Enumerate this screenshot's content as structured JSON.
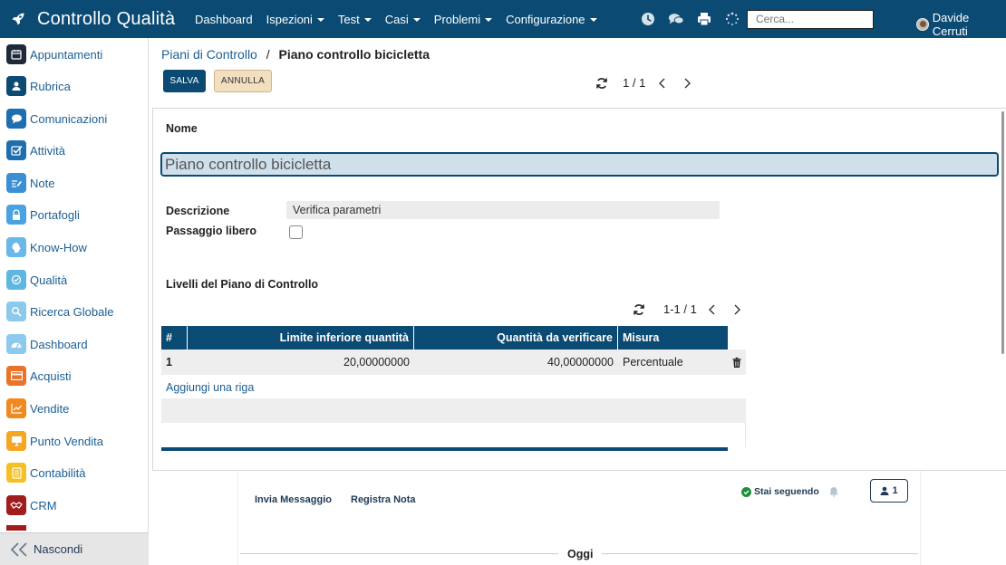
{
  "app": {
    "title": "Controllo Qualità",
    "logo_icon": "rocket-icon"
  },
  "menu": [
    {
      "label": "Dashboard",
      "dropdown": false
    },
    {
      "label": "Ispezioni",
      "dropdown": true
    },
    {
      "label": "Test",
      "dropdown": true
    },
    {
      "label": "Casi",
      "dropdown": true
    },
    {
      "label": "Problemi",
      "dropdown": true
    },
    {
      "label": "Configurazione",
      "dropdown": true
    }
  ],
  "topbar": {
    "icons": [
      "clock-icon",
      "chat-icon",
      "printer-icon",
      "loading-spinner-icon"
    ],
    "search_placeholder": "Cerca...",
    "user_name": "Davide Cerruti"
  },
  "sidebar": {
    "items": [
      {
        "label": "Appuntamenti",
        "icon": "calendar-icon",
        "color": "#1e2a3a"
      },
      {
        "label": "Rubrica",
        "icon": "contacts-icon",
        "color": "#0b4a73"
      },
      {
        "label": "Comunicazioni",
        "icon": "chat-bubble-icon",
        "color": "#1e6fb0"
      },
      {
        "label": "Attività",
        "icon": "checkbox-icon",
        "color": "#1e6fb0"
      },
      {
        "label": "Note",
        "icon": "note-icon",
        "color": "#3b8fd4"
      },
      {
        "label": "Portafogli",
        "icon": "lock-icon",
        "color": "#4aa3e0"
      },
      {
        "label": "Know-How",
        "icon": "head-icon",
        "color": "#6ab8e8"
      },
      {
        "label": "Qualità",
        "icon": "quality-icon",
        "color": "#5fb6e0"
      },
      {
        "label": "Ricerca Globale",
        "icon": "search-icon",
        "color": "#8cc9ec"
      },
      {
        "label": "Dashboard",
        "icon": "gauge-icon",
        "color": "#8cc9ec"
      },
      {
        "label": "Acquisti",
        "icon": "credit-card-icon",
        "color": "#e8742a"
      },
      {
        "label": "Vendite",
        "icon": "trend-chart-icon",
        "color": "#f08a1e"
      },
      {
        "label": "Punto Vendita",
        "icon": "monitor-icon",
        "color": "#f5a623"
      },
      {
        "label": "Contabilità",
        "icon": "ledger-icon",
        "color": "#f5c023"
      },
      {
        "label": "CRM",
        "icon": "handshake-icon",
        "color": "#a11c1c"
      }
    ],
    "hide_label": "Nascondi"
  },
  "breadcrumb": {
    "parent": "Piani di Controllo",
    "separator": "/",
    "current": "Piano controllo bicicletta"
  },
  "actions": {
    "save": "SALVA",
    "cancel": "ANNULLA"
  },
  "pager": {
    "value": "1 / 1"
  },
  "form": {
    "name_label": "Nome",
    "name_value": "Piano controllo bicicletta",
    "description_label": "Descrizione",
    "description_value": "Verifica parametri",
    "free_pass_label": "Passaggio libero",
    "free_pass_checked": false,
    "levels_label": "Livelli del Piano di Controllo"
  },
  "levels_table": {
    "pager": "1-1 / 1",
    "headers": [
      "#",
      "Limite inferiore quantità",
      "Quantità da verificare",
      "Misura"
    ],
    "rows": [
      {
        "num": "1",
        "lower_limit": "20,00000000",
        "quantity": "40,00000000",
        "measure": "Percentuale"
      }
    ],
    "add_line": "Aggiungi una riga"
  },
  "chatter": {
    "send_message": "Invia Messaggio",
    "log_note": "Registra Nota",
    "following": "Stai seguendo",
    "followers_count": "1",
    "today": "Oggi"
  },
  "colors": {
    "primary": "#0b4a73",
    "link": "#1b5e93",
    "cancel_bg": "#f2dfc0",
    "success": "#1e8e3e"
  }
}
